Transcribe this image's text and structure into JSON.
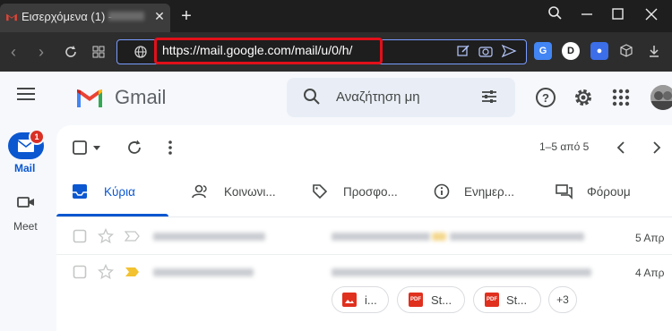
{
  "browser": {
    "tab_title": "Εισερχόμενα (1) -",
    "tab_close": "✕",
    "new_tab": "+",
    "url": "https://mail.google.com/mail/u/0/h/",
    "window_controls": [
      "search-icon",
      "minimize-icon",
      "maximize-icon",
      "close-icon"
    ],
    "extension_letter": "D"
  },
  "gmail": {
    "product_name": "Gmail",
    "search_placeholder": "Αναζήτηση μη",
    "rail": {
      "mail_label": "Mail",
      "mail_badge": "1",
      "meet_label": "Meet"
    },
    "toolbar": {
      "page_info": "1–5 από 5"
    },
    "tabs": [
      {
        "label": "Κύρια",
        "icon": "inbox-icon"
      },
      {
        "label": "Κοινωνι...",
        "icon": "people-icon"
      },
      {
        "label": "Προσφο...",
        "icon": "tag-icon"
      },
      {
        "label": "Ενημερ...",
        "icon": "info-icon"
      },
      {
        "label": "Φόρουμ",
        "icon": "forum-icon"
      }
    ],
    "rows": [
      {
        "date": "5 Απρ",
        "important": false
      },
      {
        "date": "4 Απρ",
        "important": true
      }
    ],
    "attachments": [
      {
        "label": "i...",
        "type": "image"
      },
      {
        "label": "St...",
        "type": "PDF"
      },
      {
        "label": "St...",
        "type": "PDF"
      }
    ],
    "more_attachments": "+3"
  }
}
